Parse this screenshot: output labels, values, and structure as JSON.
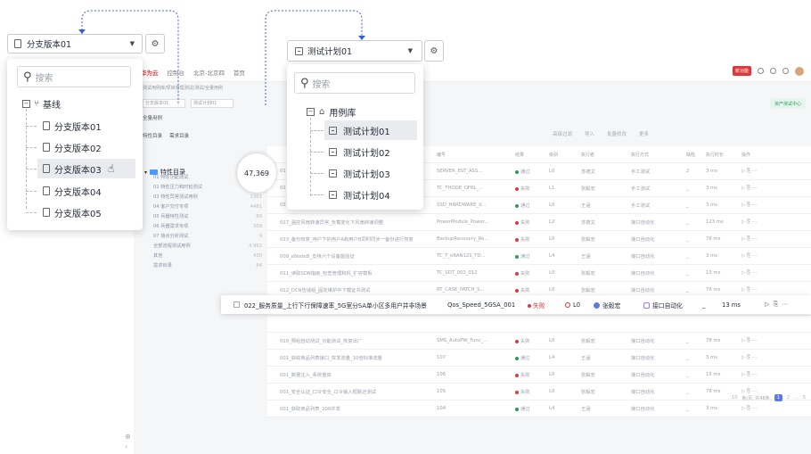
{
  "app": {
    "brand": "华为云",
    "console": "控制台",
    "region": "北京-北京四",
    "home": "首页",
    "subtitle": "测试用例库/项目管理测试/测试/全量用例",
    "branch_mini": "分支版本01",
    "plan_mini": "测试计划01",
    "tab_all": "全量用例",
    "feature_tab": "特性目录",
    "req_tab": "需求目录",
    "search_ph": "搜索",
    "badge_new": "新功能",
    "asset_btn": "资产测试中心",
    "toolbar": [
      "高级过滤",
      "导入",
      "批量修改",
      "更多"
    ],
    "columns": [
      "编号",
      "结果",
      "级别",
      "执行者",
      "执行方式",
      "缺陷",
      "执行时长",
      "操作"
    ]
  },
  "left_tree_bg": [
    {
      "label": "01 特性功能测试",
      "count": "30,001"
    },
    {
      "label": "02 特性压力和时延测试",
      "count": "2010"
    },
    {
      "label": "03 特性异常测试用例",
      "count": "1301"
    },
    {
      "label": "04 客户交付专项",
      "count": "4481"
    },
    {
      "label": "05 兵器特性测试",
      "count": "89"
    },
    {
      "label": "06 兵器需求专项",
      "count": "309"
    },
    {
      "label": "07 接点分析测试",
      "count": "9"
    },
    {
      "label": "全部流程测试用例",
      "count": "4,962"
    },
    {
      "label": "其他",
      "count": "430"
    },
    {
      "label": "需求目录",
      "count": "84"
    }
  ],
  "rows": [
    {
      "name": "01",
      "code": "SERVER_EST_ASS...",
      "result": "通过",
      "level": "L0",
      "user": "苏德文",
      "mode": "手工测试",
      "defect": "2",
      "dur": "3 ms"
    },
    {
      "name": "02",
      "code": "TC_THODE_OFRL_...",
      "result": "失败",
      "level": "L1",
      "user": "张毅宏",
      "mode": "手工测试",
      "defect": "_",
      "dur": "3 ms"
    },
    {
      "name": "03",
      "code": "SSD_HARDWARE_V...",
      "result": "通过",
      "level": "L0",
      "user": "王涵",
      "mode": "手工测试",
      "defect": "_",
      "dur": "3 ms"
    },
    {
      "name": "027_温控风扇转速异常_负载变化下风扇转速调整",
      "code": "PowerModule_Power...",
      "result": "失败",
      "level": "L2",
      "user": "苏德文",
      "mode": "接口自动化",
      "defect": "_",
      "dur": "123 ms"
    },
    {
      "name": "023_备份恢复_用户下的用户A和用户B同时同步一备份进行恢复",
      "code": "BackupRecovery_Re...",
      "result": "失败",
      "level": "L0",
      "user": "张毅宏",
      "mode": "接口自动化",
      "defect": "_",
      "dur": "78 ms"
    },
    {
      "name": "009_eNodeB_支持六个设备能验证",
      "code": "TC_T_eRAN121_TD...",
      "result": "通过",
      "level": "L4",
      "user": "王涵",
      "mode": "接口自动化",
      "defect": "_",
      "dur": "3 ms"
    },
    {
      "name": "011_读取SDN指南_检查管理和机_扩容模板",
      "code": "TC_SDT_003_012",
      "result": "失败",
      "level": "L0",
      "user": "张毅宏",
      "mode": "接口自动化",
      "defect": "_",
      "dur": "13 ms"
    },
    {
      "name": "012_DCN告诫组_固定维护中下载证书测试",
      "code": "RT_CASE_PATCH_S...",
      "result": "失败",
      "level": "L0",
      "user": "张毅宏",
      "mode": "接口自动化",
      "defect": "_",
      "dur": "78 ms"
    },
    {
      "name": "013_广域网络_SIM卡切换_切回前量自设备",
      "code": "ENT_SG_IF_000122",
      "result": "通过",
      "level": "L4",
      "user": "王涵",
      "mode": "接口自动化",
      "defect": "_",
      "dur": "3 ms"
    },
    {
      "name": "",
      "code": "",
      "result": "",
      "level": "",
      "user": "",
      "mode": "",
      "defect": "",
      "dur": ""
    },
    {
      "name": "010_预组自动测试_功能测试_恢复出厂",
      "code": "SMS_AutoPW_Func_...",
      "result": "失败",
      "level": "L0",
      "user": "张毅宏",
      "mode": "接口自动化",
      "defect": "_",
      "dur": "78 ms"
    },
    {
      "name": "001_获取商品列表接口_突发流量_10倍标准流量",
      "code": "107",
      "result": "通过",
      "level": "L4",
      "user": "王涵",
      "mode": "接口自动化",
      "defect": "_",
      "dur": "3 ms"
    },
    {
      "name": "001_数据注入_系统重启",
      "code": "106",
      "result": "失败",
      "level": "L0",
      "user": "张毅宏",
      "mode": "接口自动化",
      "defect": "_",
      "dur": "13 ms"
    },
    {
      "name": "001_安全认证_口令安全_口令输入框脱还测试",
      "code": "105",
      "result": "失败",
      "level": "L0",
      "user": "张毅宏",
      "mode": "接口自动化",
      "defect": "_",
      "dur": "78 ms"
    },
    {
      "name": "001_获取商品列表_200并发",
      "code": "104",
      "result": "通过",
      "level": "L4",
      "user": "王涵",
      "mode": "接口自动化",
      "defect": "_",
      "dur": "3 ms"
    }
  ],
  "pager": {
    "size": "10",
    "info": "条/页, 共48条",
    "pages": [
      "1",
      "2",
      "...",
      "5"
    ]
  },
  "highlight_row": {
    "name": "022_服务质量_上行下行保障速率_5G室分SA单小区多用户并非场景",
    "code": "Qos_Speed_5GSA_001",
    "result": "失败",
    "level": "L0",
    "user": "张毅宏",
    "mode": "接口自动化",
    "defect": "_",
    "duration": "13 ms"
  },
  "category": {
    "label": "特性目录",
    "count": "47,369"
  },
  "branch_dropdown": {
    "selected": "分支版本01",
    "search_placeholder": "搜索",
    "root": "基线",
    "items": [
      "分支版本01",
      "分支版本02",
      "分支版本03",
      "分支版本04",
      "分支版本05"
    ]
  },
  "plan_dropdown": {
    "selected": "测试计划01",
    "search_placeholder": "搜索",
    "root": "用例库",
    "items": [
      "测试计划01",
      "测试计划02",
      "测试计划03",
      "测试计划04"
    ]
  },
  "colors": {
    "accent": "#5e7ce0",
    "fail": "#e0373b",
    "pass": "#2b9b5c",
    "connector": "#3a5fd0"
  }
}
